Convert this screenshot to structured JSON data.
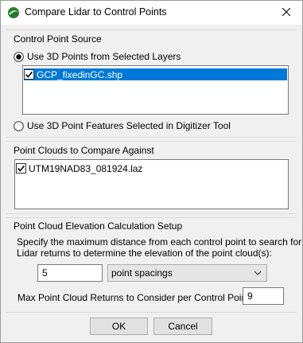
{
  "window": {
    "title": "Compare Lidar to Control Points"
  },
  "control_point_source": {
    "group_label": "Control Point Source",
    "option_layers": {
      "label": "Use 3D Points from Selected Layers",
      "selected": true
    },
    "layers": [
      {
        "name": "GCP_fixedinGC.shp",
        "checked": true,
        "selected": true
      }
    ],
    "option_digitizer": {
      "label": "Use 3D Point Features Selected in Digitizer Tool",
      "selected": false
    }
  },
  "point_clouds": {
    "group_label": "Point Clouds to Compare Against",
    "items": [
      {
        "name": "UTM19NAD83_081924.laz",
        "checked": true
      }
    ]
  },
  "elevation_setup": {
    "group_label": "Point Cloud Elevation Calculation Setup",
    "description_line1": "Specify the maximum distance from each control point to search for",
    "description_line2": "Lidar returns to determine the elevation of the point cloud(s):",
    "distance_value": "5",
    "distance_unit": "point spacings",
    "max_returns_label": "Max Point Cloud Returns to Consider per Control Point:",
    "max_returns_value": "9"
  },
  "buttons": {
    "ok": "OK",
    "cancel": "Cancel"
  }
}
